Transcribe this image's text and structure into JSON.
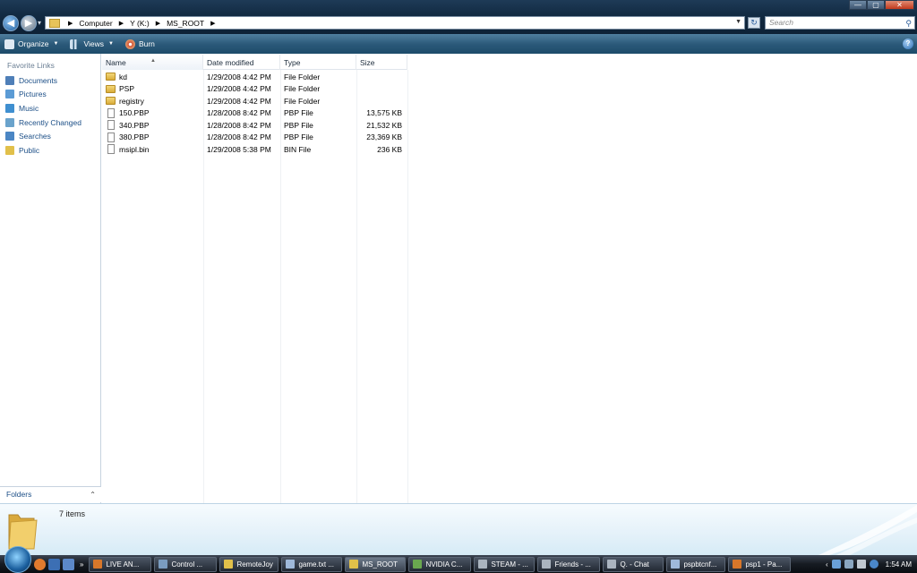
{
  "window": {
    "buttons": {
      "minimize": "—",
      "maximize": "▢",
      "close": "✕"
    }
  },
  "address": {
    "crumbs": [
      "Computer",
      "Y (K:)",
      "MS_ROOT"
    ],
    "search_placeholder": "Search"
  },
  "toolbar": {
    "organize": "Organize",
    "views": "Views",
    "burn": "Burn",
    "help": "?"
  },
  "navpane": {
    "heading": "Favorite Links",
    "items": [
      {
        "label": "Documents",
        "icon": "documents-icon"
      },
      {
        "label": "Pictures",
        "icon": "pictures-icon"
      },
      {
        "label": "Music",
        "icon": "music-icon"
      },
      {
        "label": "Recently Changed",
        "icon": "recently-changed-icon"
      },
      {
        "label": "Searches",
        "icon": "searches-icon"
      },
      {
        "label": "Public",
        "icon": "public-icon"
      }
    ],
    "folders_label": "Folders"
  },
  "columns": {
    "name": "Name",
    "date": "Date modified",
    "type": "Type",
    "size": "Size"
  },
  "files": [
    {
      "name": "kd",
      "date": "1/29/2008 4:42 PM",
      "type": "File Folder",
      "size": "",
      "kind": "folder"
    },
    {
      "name": "PSP",
      "date": "1/29/2008 4:42 PM",
      "type": "File Folder",
      "size": "",
      "kind": "folder"
    },
    {
      "name": "registry",
      "date": "1/29/2008 4:42 PM",
      "type": "File Folder",
      "size": "",
      "kind": "folder"
    },
    {
      "name": "150.PBP",
      "date": "1/28/2008 8:42 PM",
      "type": "PBP File",
      "size": "13,575 KB",
      "kind": "file"
    },
    {
      "name": "340.PBP",
      "date": "1/28/2008 8:42 PM",
      "type": "PBP File",
      "size": "21,532 KB",
      "kind": "file"
    },
    {
      "name": "380.PBP",
      "date": "1/28/2008 8:42 PM",
      "type": "PBP File",
      "size": "23,369 KB",
      "kind": "file"
    },
    {
      "name": "msipl.bin",
      "date": "1/29/2008 5:38 PM",
      "type": "BIN File",
      "size": "236 KB",
      "kind": "file"
    }
  ],
  "details": {
    "count": "7 items"
  },
  "taskbar": {
    "more": "»",
    "tasks": [
      {
        "label": "LIVE AN...",
        "color": "#d8772a"
      },
      {
        "label": "Control ...",
        "color": "#7a9cc0"
      },
      {
        "label": "RemoteJoy",
        "color": "#e1c04a"
      },
      {
        "label": "game.txt ...",
        "color": "#9fb9da"
      },
      {
        "label": "MS_ROOT",
        "color": "#e1c04a",
        "active": true
      },
      {
        "label": "NVIDIA C...",
        "color": "#6aa84f"
      },
      {
        "label": "STEAM - ...",
        "color": "#aab4bf"
      },
      {
        "label": "Friends - ...",
        "color": "#aab4bf"
      },
      {
        "label": "Q. - Chat",
        "color": "#aab4bf"
      },
      {
        "label": "pspbtcnf...",
        "color": "#9fb9da"
      },
      {
        "label": "psp1 - Pa...",
        "color": "#d8772a"
      }
    ],
    "tray": {
      "arrow": "‹",
      "clock": "1:54 AM"
    }
  }
}
